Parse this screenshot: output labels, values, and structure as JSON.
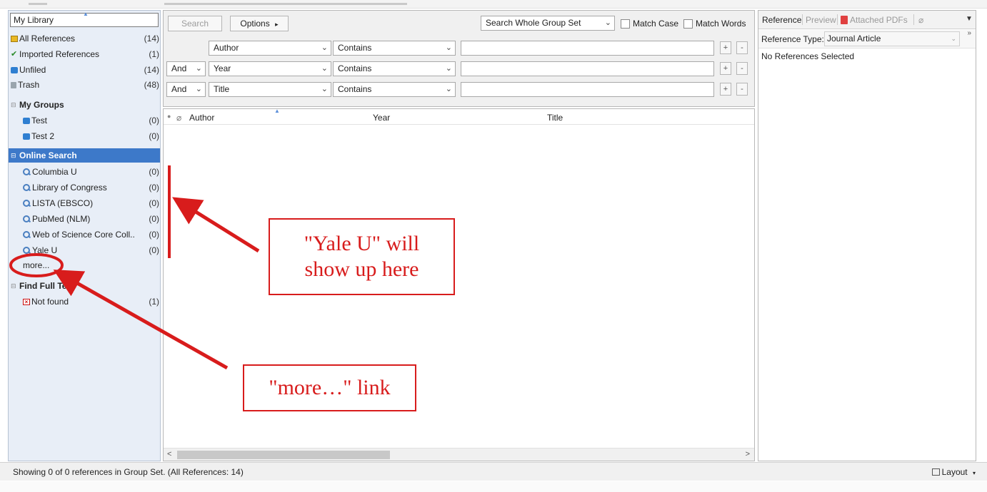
{
  "library_title": "My Library",
  "library_items": [
    {
      "label": "All References",
      "count": "(14)",
      "icon": "all-references-icon"
    },
    {
      "label": "Imported References",
      "count": "(1)",
      "icon": "imported-check-icon"
    },
    {
      "label": "Unfiled",
      "count": "(14)",
      "icon": "unfiled-folder-icon"
    },
    {
      "label": "Trash",
      "count": "(48)",
      "icon": "trash-icon"
    }
  ],
  "my_groups": {
    "label": "My Groups",
    "items": [
      {
        "label": "Test",
        "count": "(0)"
      },
      {
        "label": "Test 2",
        "count": "(0)"
      }
    ]
  },
  "online_search": {
    "label": "Online Search",
    "items": [
      {
        "label": "Columbia U",
        "count": "(0)"
      },
      {
        "label": "Library of Congress",
        "count": "(0)"
      },
      {
        "label": "LISTA (EBSCO)",
        "count": "(0)"
      },
      {
        "label": "PubMed (NLM)",
        "count": "(0)"
      },
      {
        "label": "Web of Science Core Coll...",
        "count": "(0)"
      },
      {
        "label": "Yale U",
        "count": "(0)"
      }
    ],
    "more_label": "more..."
  },
  "find_full_text": {
    "label": "Find Full Text",
    "items": [
      {
        "label": "Not found",
        "count": "(1)"
      }
    ]
  },
  "search": {
    "search_button": "Search",
    "options_button": "Options",
    "options_arrow": "▸",
    "scope": "Search Whole Group Set",
    "match_case": "Match Case",
    "match_words": "Match Words",
    "rows": [
      {
        "bool": "",
        "field": "Author",
        "op": "Contains"
      },
      {
        "bool": "And",
        "field": "Year",
        "op": "Contains"
      },
      {
        "bool": "And",
        "field": "Title",
        "op": "Contains"
      }
    ]
  },
  "list": {
    "columns": [
      "Author",
      "Year",
      "Title"
    ]
  },
  "right_panel": {
    "tabs": [
      "Reference",
      "Preview",
      "Attached PDFs"
    ],
    "ref_type_label": "Reference Type:",
    "ref_type_value": "Journal Article",
    "no_selection": "No References Selected"
  },
  "status": {
    "text": "Showing 0 of 0 references in Group Set. (All References: 14)",
    "layout": "Layout"
  },
  "annotations": {
    "yale_callout_line1": "\"Yale U\" will",
    "yale_callout_line2": "show up here",
    "more_callout": "\"more…\" link",
    "color": "#d81c1c"
  },
  "colors": {
    "selected_group": "#3d79c9",
    "left_panel_bg": "#e8eef7",
    "annotation_red": "#d81c1c"
  }
}
